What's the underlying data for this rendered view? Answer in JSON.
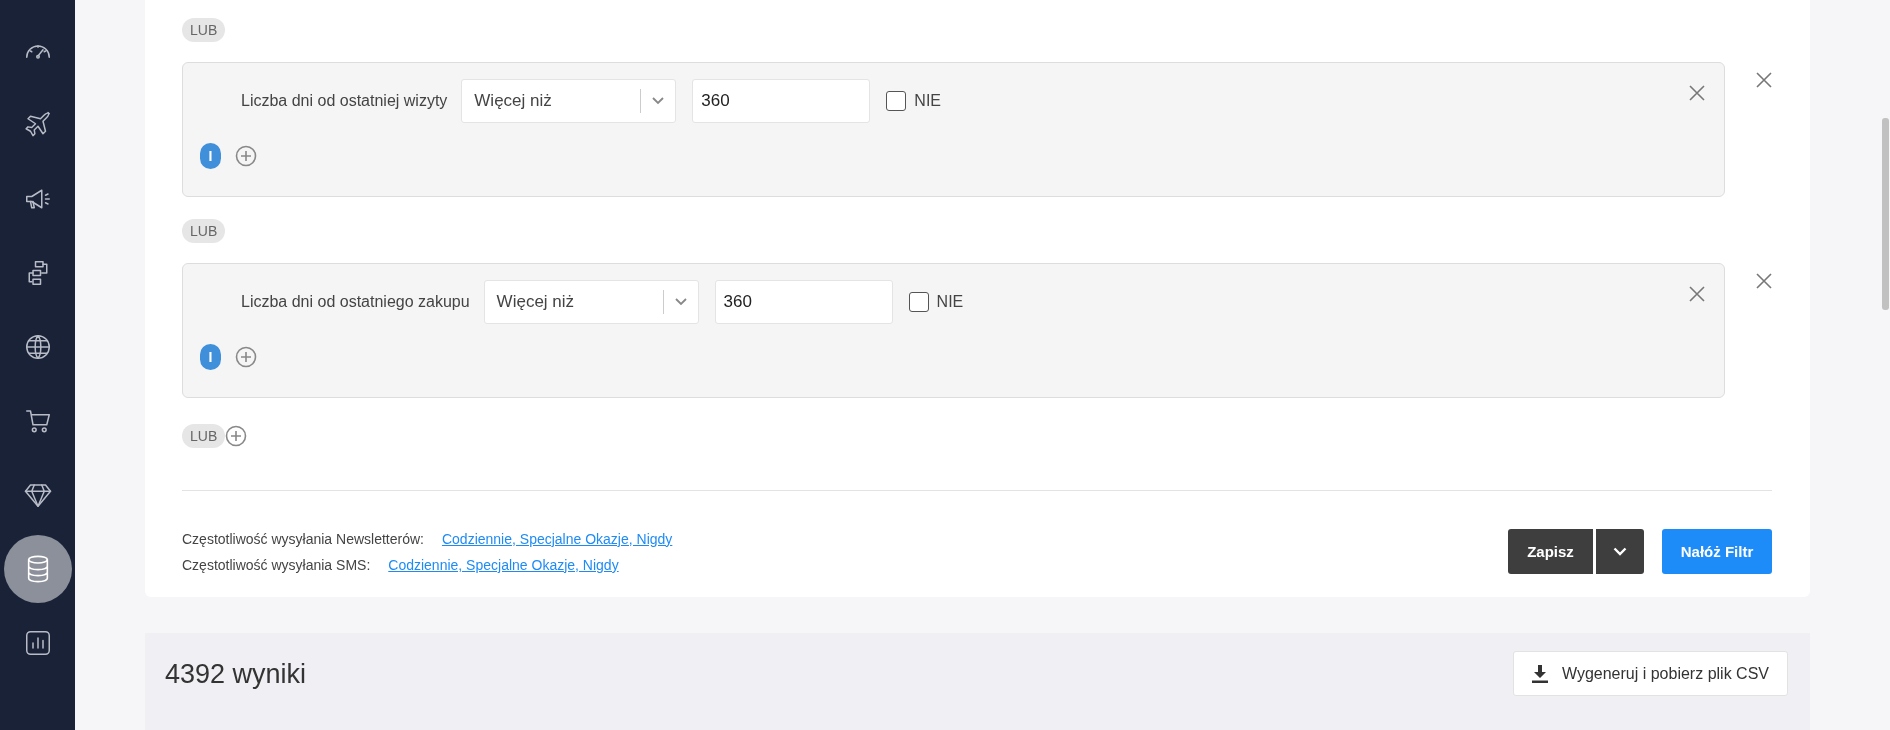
{
  "sidebar": {
    "items": [
      {
        "selected": false
      },
      {
        "selected": false
      },
      {
        "selected": false
      },
      {
        "selected": false
      },
      {
        "selected": false
      },
      {
        "selected": false
      },
      {
        "selected": false
      },
      {
        "selected": true
      },
      {
        "selected": false
      }
    ]
  },
  "groups": [
    {
      "or_label": "LUB",
      "label": "Liczba dni od ostatniej wizyty",
      "operator": "Więcej niż",
      "value": "360",
      "negate": {
        "label": "NIE",
        "checked": false
      },
      "and_label": "I"
    },
    {
      "or_label": "LUB",
      "label": "Liczba dni od ostatniego zakupu",
      "operator": "Więcej niż",
      "value": "360",
      "negate": {
        "label": "NIE",
        "checked": false
      },
      "and_label": "I"
    }
  ],
  "add_or": {
    "label": "LUB"
  },
  "frequencies": [
    {
      "label": "Częstotliwość wysyłania Newsletterów:",
      "value": "Codziennie, Specjalne Okazje, Nigdy"
    },
    {
      "label": "Częstotliwość wysyłania SMS:",
      "value": "Codziennie, Specjalne Okazje, Nigdy"
    }
  ],
  "save_button": "Zapisz",
  "apply_button": "Nałóż Filtr",
  "results": {
    "count": "4392 wyniki",
    "csv_button": "Wygeneruj i pobierz plik CSV"
  }
}
